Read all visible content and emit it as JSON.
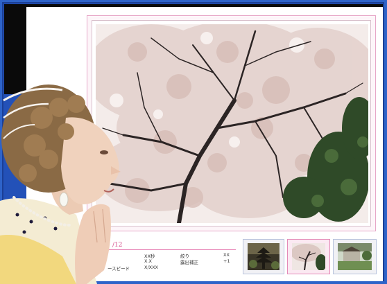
{
  "info": {
    "photo_counter": "/12",
    "row1_value": "XX秒",
    "row1_label2": "絞り",
    "row1_value2": "XX",
    "row2_value": "X.X",
    "row2_label2": "露出補正",
    "row2_value2": "+1",
    "row3_label": "ースピード",
    "row3_value": "X/XXX"
  },
  "thumbnails": [
    {
      "name": "pagoda",
      "selected": false
    },
    {
      "name": "cherry-tree",
      "selected": true
    },
    {
      "name": "shrine-garden",
      "selected": false
    }
  ],
  "colors": {
    "frame": "#2e63c9",
    "accent_pink": "#e680b3",
    "blossom": "#e9d9d6",
    "branch": "#2b2424",
    "leaf": "#2f4a28"
  }
}
